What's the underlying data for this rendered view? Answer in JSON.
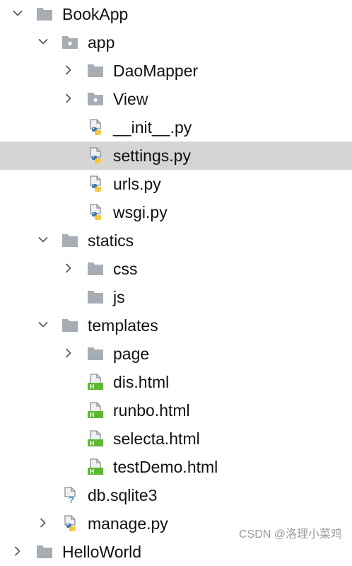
{
  "tree": {
    "items": [
      {
        "label": "BookApp",
        "level": 0,
        "expandable": true,
        "expanded": true,
        "icon": "folder-icon",
        "selected": false
      },
      {
        "label": "app",
        "level": 1,
        "expandable": true,
        "expanded": true,
        "icon": "package-folder-icon",
        "selected": false
      },
      {
        "label": "DaoMapper",
        "level": 2,
        "expandable": true,
        "expanded": false,
        "icon": "folder-icon",
        "selected": false
      },
      {
        "label": "View",
        "level": 2,
        "expandable": true,
        "expanded": false,
        "icon": "package-folder-icon",
        "selected": false
      },
      {
        "label": "__init__.py",
        "level": 2,
        "expandable": false,
        "expanded": false,
        "icon": "python-file-icon",
        "selected": false
      },
      {
        "label": "settings.py",
        "level": 2,
        "expandable": false,
        "expanded": false,
        "icon": "python-file-icon",
        "selected": true
      },
      {
        "label": "urls.py",
        "level": 2,
        "expandable": false,
        "expanded": false,
        "icon": "python-file-icon",
        "selected": false
      },
      {
        "label": "wsgi.py",
        "level": 2,
        "expandable": false,
        "expanded": false,
        "icon": "python-file-icon",
        "selected": false
      },
      {
        "label": "statics",
        "level": 1,
        "expandable": true,
        "expanded": true,
        "icon": "folder-icon",
        "selected": false
      },
      {
        "label": "css",
        "level": 2,
        "expandable": true,
        "expanded": false,
        "icon": "folder-icon",
        "selected": false
      },
      {
        "label": "js",
        "level": 2,
        "expandable": false,
        "expanded": false,
        "icon": "folder-icon",
        "selected": false
      },
      {
        "label": "templates",
        "level": 1,
        "expandable": true,
        "expanded": true,
        "icon": "folder-icon",
        "selected": false
      },
      {
        "label": "page",
        "level": 2,
        "expandable": true,
        "expanded": false,
        "icon": "folder-icon",
        "selected": false
      },
      {
        "label": "dis.html",
        "level": 2,
        "expandable": false,
        "expanded": false,
        "icon": "html-file-icon",
        "selected": false
      },
      {
        "label": "runbo.html",
        "level": 2,
        "expandable": false,
        "expanded": false,
        "icon": "html-file-icon",
        "selected": false
      },
      {
        "label": "selecta.html",
        "level": 2,
        "expandable": false,
        "expanded": false,
        "icon": "html-file-icon",
        "selected": false
      },
      {
        "label": "testDemo.html",
        "level": 2,
        "expandable": false,
        "expanded": false,
        "icon": "html-file-icon",
        "selected": false
      },
      {
        "label": "db.sqlite3",
        "level": 1,
        "expandable": false,
        "expanded": false,
        "icon": "unknown-file-icon",
        "selected": false
      },
      {
        "label": "manage.py",
        "level": 1,
        "expandable": true,
        "expanded": false,
        "icon": "python-file-icon",
        "selected": false
      },
      {
        "label": "HelloWorld",
        "level": 0,
        "expandable": true,
        "expanded": false,
        "icon": "folder-icon",
        "selected": false
      }
    ]
  },
  "watermark": "CSDN @洛理小菜鸡",
  "colors": {
    "folder": "#a7adb3",
    "selection": "#d5d5d5",
    "python_blue": "#3b77a8",
    "python_yellow": "#f7c43b",
    "html_green": "#5fb832",
    "unknown_blue": "#3d8fd6"
  }
}
